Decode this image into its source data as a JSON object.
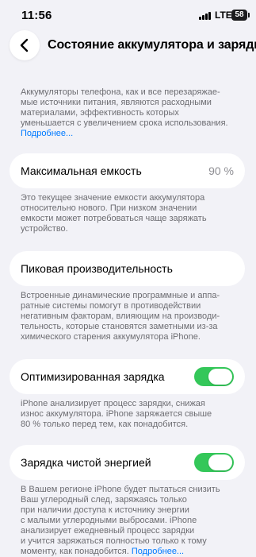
{
  "status_bar": {
    "time": "11:56",
    "network": "LTE",
    "battery": "58"
  },
  "nav": {
    "title": "Состояние аккумулятора и зарядка"
  },
  "intro": {
    "lines": [
      "Аккумуляторы телефона, как и все перезаряжае-",
      "мые источники питания, являются расходными",
      "материалами, эффективность которых",
      "уменьшается с увеличением срока использования."
    ],
    "link": "Подробнее..."
  },
  "max_capacity": {
    "label": "Максимальная емкость",
    "value": "90 %",
    "note": [
      "Это текущее значение емкости аккумулятора",
      "относительно нового. При низком значении",
      "емкости может потребоваться чаще заряжать",
      "устройство."
    ]
  },
  "peak_performance": {
    "label": "Пиковая производительность",
    "note": [
      "Встроенные динамические программные и аппа-",
      "ратные системы помогут в противодействии",
      "негативным факторам, влияющим на производи-",
      "тельность, которые становятся заметными из-за",
      "химического старения аккумулятора iPhone."
    ]
  },
  "optimized_charging": {
    "label": "Оптимизированная зарядка",
    "enabled": true,
    "note": [
      "iPhone анализирует процесс зарядки, снижая",
      "износ аккумулятора. iPhone заряжается свыше",
      "80 % только перед тем, как понадобится."
    ]
  },
  "clean_energy": {
    "label": "Зарядка чистой энергией",
    "enabled": true,
    "note": [
      "В Вашем регионе iPhone будет пытаться снизить",
      "Ваш углеродный след, заряжаясь только",
      "при наличии доступа к источнику энергии",
      "с малыми углеродными выбросами. iPhone",
      "анализирует ежедневный процесс зарядки",
      "и учится заряжаться полностью только к тому"
    ],
    "last_line": "моменту, как понадобится.",
    "link": "Подробнее..."
  },
  "colors": {
    "toggle_on": "#34c759",
    "link": "#007aff",
    "background": "#f2f2f7"
  }
}
